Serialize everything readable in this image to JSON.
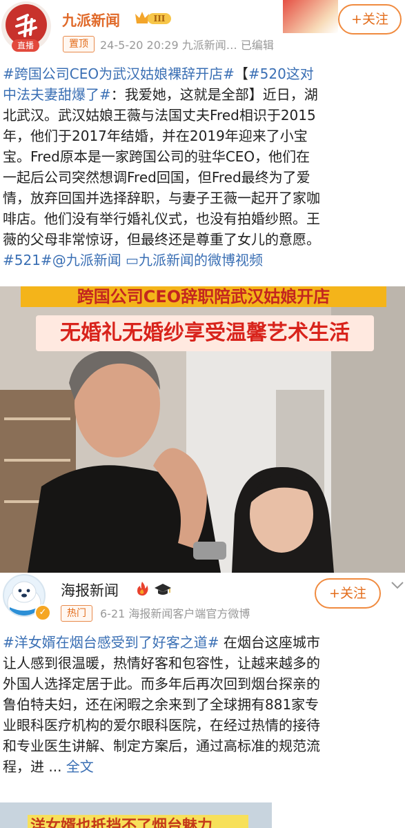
{
  "post1": {
    "author": "九派新闻",
    "vip_level": "III",
    "live_badge": "直播",
    "follow_label": "+关注",
    "pin_tag": "置顶",
    "meta": "24-5-20 20:29  九派新闻…  已编辑",
    "lines": [
      [
        {
          "t": "#跨国公司CEO为武汉姑娘裸辞开店#",
          "link": true
        },
        {
          "t": "【",
          "link": false
        },
        {
          "t": "#520这对",
          "link": true
        }
      ],
      [
        {
          "t": "中法夫妻甜爆了#",
          "link": true
        },
        {
          "t": "：我爱她，这就是全部】近日，湖",
          "link": false
        }
      ],
      [
        {
          "t": "北武汉。武汉姑娘王薇与法国丈夫Fred相识于2015",
          "link": false
        }
      ],
      [
        {
          "t": "年，他们于2017年结婚，并在2019年迎来了小宝",
          "link": false
        }
      ],
      [
        {
          "t": "宝。Fred原本是一家跨国公司的驻华CEO，他们在",
          "link": false
        }
      ],
      [
        {
          "t": "一起后公司突然想调Fred回国，但Fred最终为了爱",
          "link": false
        }
      ],
      [
        {
          "t": "情，放弃回国并选择辞职，与妻子王薇一起开了家咖",
          "link": false
        }
      ],
      [
        {
          "t": "啡店。他们没有举行婚礼仪式，也没有拍婚纱照。王",
          "link": false
        }
      ],
      [
        {
          "t": "薇的父母非常惊讶，但最终还是尊重了女儿的意愿。",
          "link": false
        }
      ],
      [
        {
          "t": "#521#@九派新闻 ",
          "link": true
        },
        {
          "t": "▭九派新闻的微博视频",
          "link": true
        }
      ]
    ],
    "image_caption_top": "跨国公司CEO辞职陪武汉姑娘开店",
    "image_caption_main": "无婚礼无婚纱享受温馨艺术生活"
  },
  "post2": {
    "author": "海报新闻",
    "follow_label": "+关注",
    "hot_tag": "热门",
    "meta": "6-21   海报新闻客户端官方微博",
    "lines": [
      [
        {
          "t": "#洋女婿在烟台感受到了好客之道#",
          "link": true
        },
        {
          "t": " 在烟台这座城市",
          "link": false
        }
      ],
      [
        {
          "t": "让人感到很温暖，热情好客和包容性，让越来越多的",
          "link": false
        }
      ],
      [
        {
          "t": "外国人选择定居于此。而多年后再次回到烟台探亲的",
          "link": false
        }
      ],
      [
        {
          "t": "鲁伯特夫妇，还在闲暇之余来到了全球拥有881家专",
          "link": false
        }
      ],
      [
        {
          "t": "业眼科医疗机构的爱尔眼科医院，在经过热情的接待",
          "link": false
        }
      ],
      [
        {
          "t": "和专业医生讲解、制定方案后，通过高标准的规范流",
          "link": false
        }
      ],
      [
        {
          "t": "程，进 ... ",
          "link": false
        },
        {
          "t": "全文",
          "link": true
        }
      ]
    ],
    "image_caption": "洋女婿也抵挡不了烟台魅力"
  },
  "colors": {
    "accent_orange": "#e36c1a",
    "link_blue": "#3a6fb4",
    "brand_red": "#c8322c"
  },
  "icons": [
    "jiupai-logo-icon",
    "vip-crown-icon",
    "fire-icon",
    "graduation-cap-icon",
    "verified-icon",
    "more-icon",
    "video-icon"
  ]
}
